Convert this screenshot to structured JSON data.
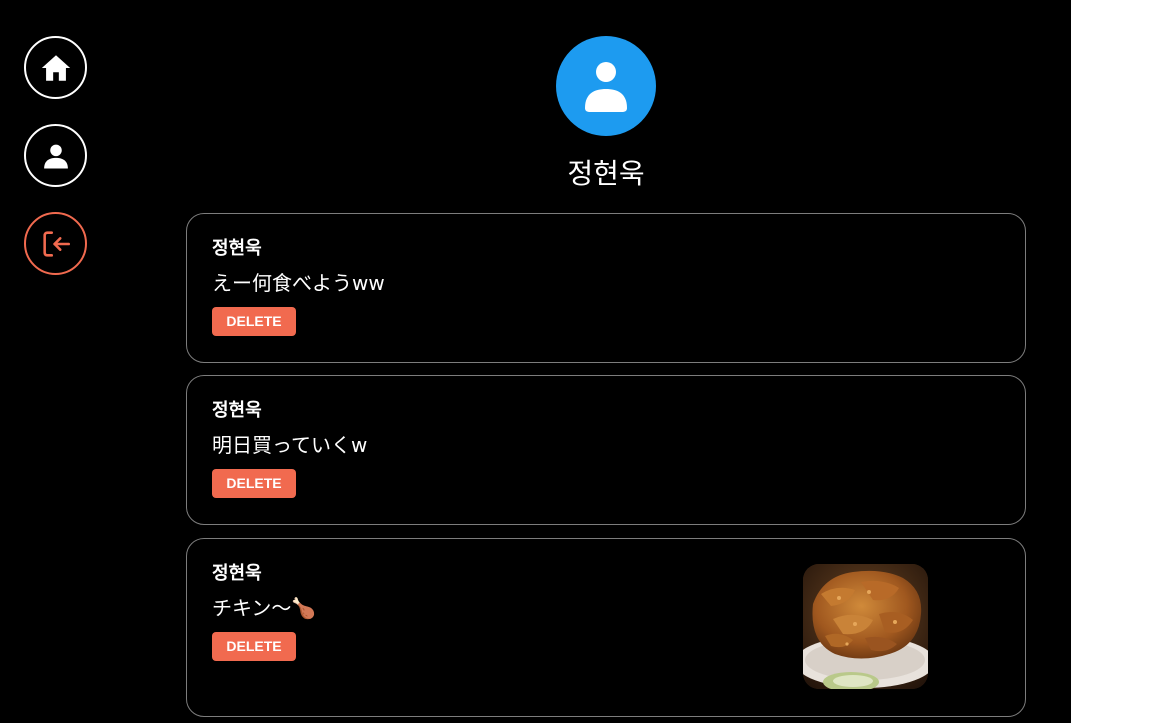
{
  "nav": {
    "items": [
      {
        "icon": "home-icon"
      },
      {
        "icon": "user-icon"
      },
      {
        "icon": "logout-icon"
      }
    ]
  },
  "profile": {
    "avatar_icon": "user-icon",
    "avatar_color": "#1d9bf0",
    "name": "정현욱"
  },
  "posts": [
    {
      "author": "정현욱",
      "text": "えー何食べようww",
      "delete_label": "DELETE"
    },
    {
      "author": "정현욱",
      "text": "明日買っていくw",
      "delete_label": "DELETE"
    },
    {
      "author": "정현욱",
      "text": "チキン〜🍗",
      "delete_label": "DELETE",
      "photo": "fried-chicken-photo"
    }
  ],
  "colors": {
    "accent": "#f16a4f",
    "avatar": "#1d9bf0",
    "background": "#000000",
    "border": "#7d7d7d"
  }
}
